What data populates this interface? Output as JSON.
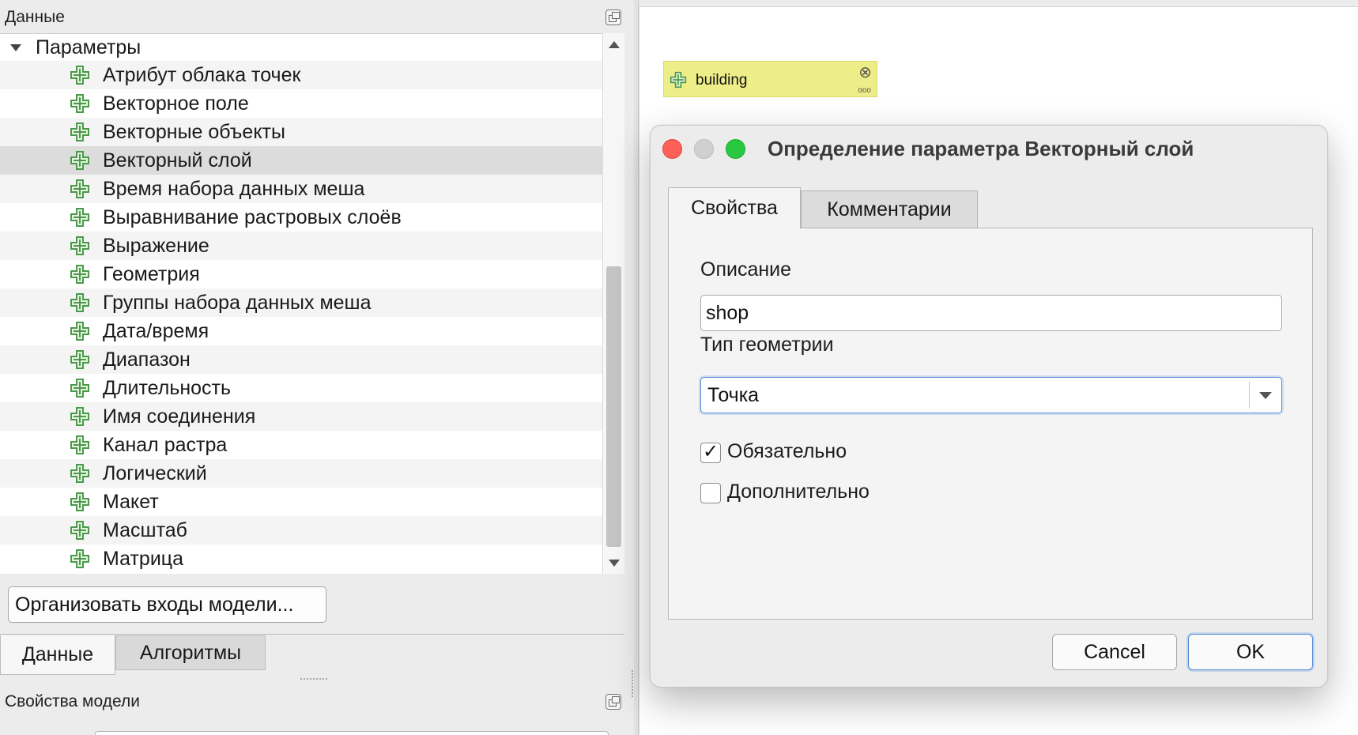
{
  "left_panel": {
    "title": "Данные",
    "tree": {
      "root_label": "Параметры",
      "items": [
        {
          "label": "Атрибут облака точек",
          "selected": false
        },
        {
          "label": "Векторное поле",
          "selected": false
        },
        {
          "label": "Векторные объекты",
          "selected": false
        },
        {
          "label": "Векторный слой",
          "selected": true
        },
        {
          "label": "Время набора данных меша",
          "selected": false
        },
        {
          "label": "Выравнивание растровых слоёв",
          "selected": false
        },
        {
          "label": "Выражение",
          "selected": false
        },
        {
          "label": "Геометрия",
          "selected": false
        },
        {
          "label": "Группы набора данных меша",
          "selected": false
        },
        {
          "label": "Дата/время",
          "selected": false
        },
        {
          "label": "Диапазон",
          "selected": false
        },
        {
          "label": "Длительность",
          "selected": false
        },
        {
          "label": "Имя соединения",
          "selected": false
        },
        {
          "label": "Канал растра",
          "selected": false
        },
        {
          "label": "Логический",
          "selected": false
        },
        {
          "label": "Макет",
          "selected": false
        },
        {
          "label": "Масштаб",
          "selected": false
        },
        {
          "label": "Матрица",
          "selected": false
        }
      ]
    },
    "organize_button": "Организовать входы модели...",
    "tabs": [
      {
        "label": "Данные",
        "active": true
      },
      {
        "label": "Алгоритмы",
        "active": false
      }
    ],
    "model_properties_title": "Свойства модели"
  },
  "canvas": {
    "node": {
      "label": "building",
      "color": "#eeee88",
      "icon": "plus-icon"
    }
  },
  "dialog": {
    "title": "Определение параметра Векторный слой",
    "tabs": [
      {
        "label": "Свойства",
        "active": true
      },
      {
        "label": "Комментарии",
        "active": false
      }
    ],
    "description_label": "Описание",
    "description_value": "shop",
    "geometry_label": "Тип геометрии",
    "geometry_value": "Точка",
    "mandatory": {
      "label": "Обязательно",
      "checked": true
    },
    "advanced": {
      "label": "Дополнительно",
      "checked": false
    },
    "cancel_label": "Cancel",
    "ok_label": "OK"
  },
  "colors": {
    "plus_icon_green": "#4a9a4a",
    "focus_blue": "#5b94dd"
  }
}
